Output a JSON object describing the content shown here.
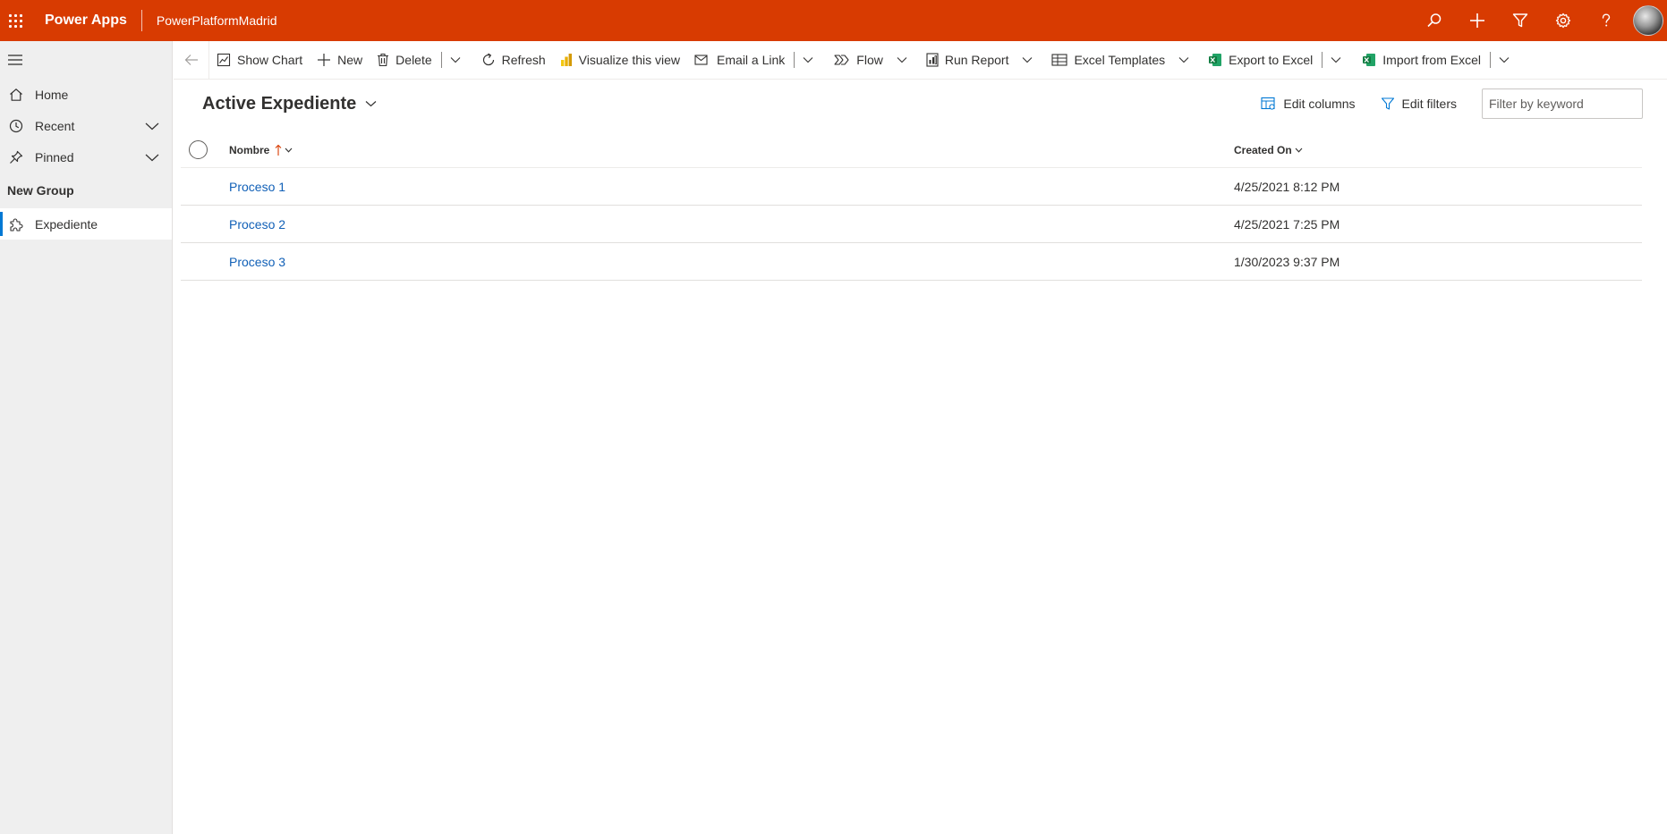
{
  "header": {
    "app_name": "Power Apps",
    "environment": "PowerPlatformMadrid",
    "brand_color": "#d83b01",
    "actions": [
      "search-icon",
      "plus-icon",
      "filter-icon",
      "gear-icon",
      "help-icon",
      "avatar"
    ]
  },
  "sidebar": {
    "items": [
      {
        "label": "Home",
        "icon": "home-icon"
      },
      {
        "label": "Recent",
        "icon": "clock-icon"
      },
      {
        "label": "Pinned",
        "icon": "pin-icon"
      }
    ],
    "group_title": "New Group",
    "group_items": [
      {
        "label": "Expediente",
        "icon": "puzzle-icon",
        "active": true
      }
    ]
  },
  "commandbar": {
    "show_chart": "Show Chart",
    "new": "New",
    "delete": "Delete",
    "refresh": "Refresh",
    "visualize": "Visualize this view",
    "email_link": "Email a Link",
    "flow": "Flow",
    "run_report": "Run Report",
    "excel_templates": "Excel Templates",
    "export_excel": "Export to Excel",
    "import_excel": "Import from Excel"
  },
  "view": {
    "title": "Active Expediente",
    "edit_columns": "Edit columns",
    "edit_filters": "Edit filters",
    "filter_placeholder": "Filter by keyword"
  },
  "grid": {
    "columns": [
      "Nombre",
      "Created On"
    ],
    "rows": [
      {
        "name": "Proceso 1",
        "created_on": "4/25/2021 8:12 PM"
      },
      {
        "name": "Proceso 2",
        "created_on": "4/25/2021 7:25 PM"
      },
      {
        "name": "Proceso 3",
        "created_on": "1/30/2023 9:37 PM"
      }
    ]
  }
}
